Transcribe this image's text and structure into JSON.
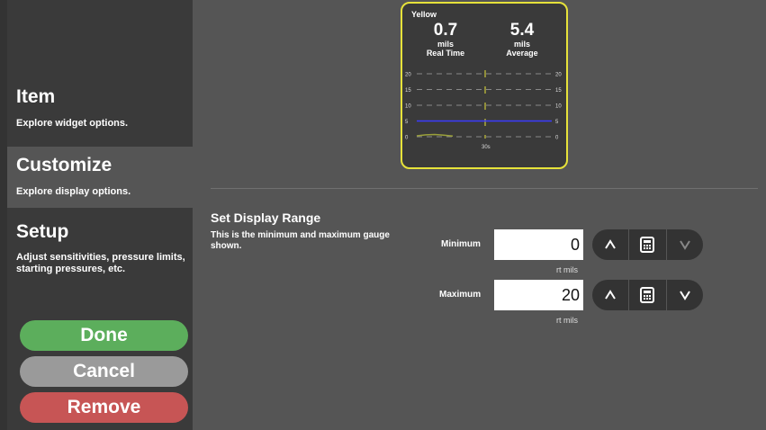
{
  "sidebar": {
    "items": [
      {
        "title": "Item",
        "desc": "Explore widget options."
      },
      {
        "title": "Customize",
        "desc": "Explore display options."
      },
      {
        "title": "Setup",
        "desc": "Adjust sensitivities, pressure limits, starting pressures, etc."
      }
    ],
    "done_label": "Done",
    "cancel_label": "Cancel",
    "remove_label": "Remove"
  },
  "gauge": {
    "name": "Yellow",
    "realtime": {
      "value": "0.7",
      "unit": "mils",
      "label": "Real Time"
    },
    "average": {
      "value": "5.4",
      "unit": "mils",
      "label": "Average"
    },
    "border_color": "#e6e23a"
  },
  "chart_data": {
    "type": "line",
    "y_ticks": [
      "20",
      "15",
      "10",
      "5",
      "0"
    ],
    "ylim": [
      0,
      20
    ],
    "x_tick_label": "30s",
    "grid": true,
    "series": [
      {
        "values": [
          5,
          5,
          5,
          5,
          5,
          5,
          5,
          5,
          5,
          5
        ],
        "color": "#3b3bff"
      },
      {
        "values": [
          0.3,
          0.6,
          0.7,
          0.5,
          0.2
        ],
        "color": "#9aa03a"
      }
    ]
  },
  "range": {
    "title": "Set Display Range",
    "desc": "This is the minimum and maximum gauge shown.",
    "minimum": {
      "label": "Minimum",
      "value": "0",
      "unit": "rt mils"
    },
    "maximum": {
      "label": "Maximum",
      "value": "20",
      "unit": "rt mils"
    }
  },
  "colors": {
    "done": "#5cae5c",
    "cancel": "#9a9a9a",
    "remove": "#c75555",
    "accent": "#e6e23a"
  }
}
